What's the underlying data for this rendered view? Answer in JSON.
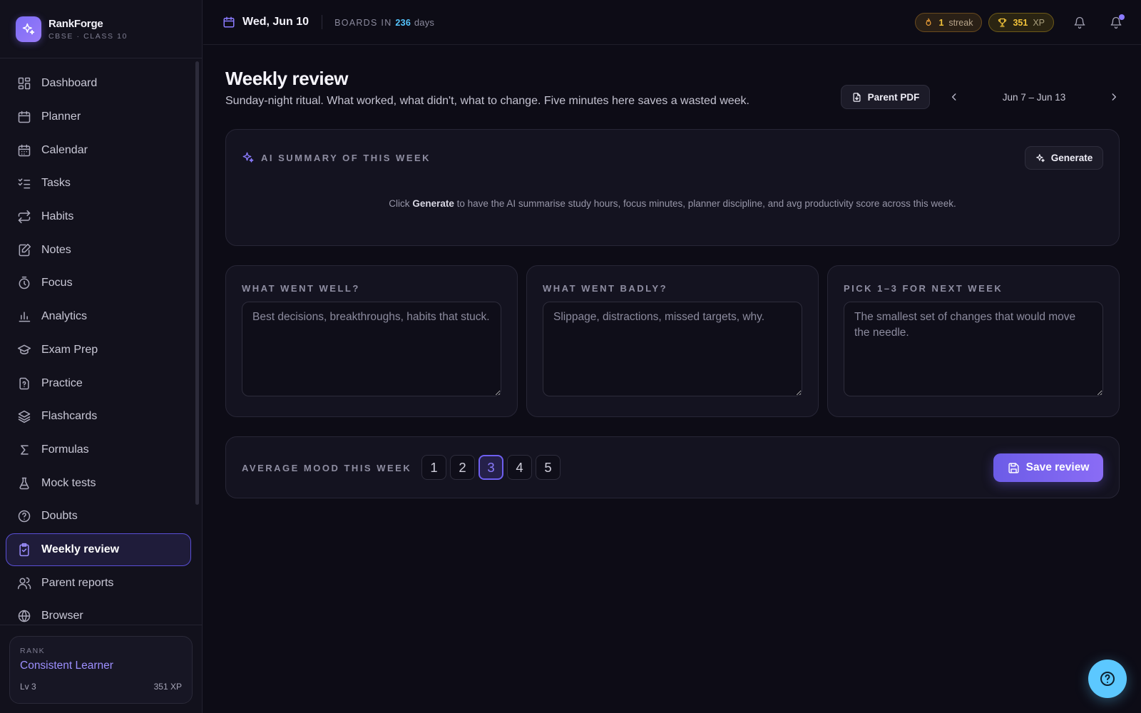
{
  "brand": {
    "name": "RankForge",
    "sub": "CBSE · CLASS 10"
  },
  "sidebar": {
    "items": [
      {
        "label": "Dashboard",
        "icon": "dashboard-icon"
      },
      {
        "label": "Planner",
        "icon": "calendar-icon"
      },
      {
        "label": "Calendar",
        "icon": "calendar-grid-icon"
      },
      {
        "label": "Tasks",
        "icon": "checklist-icon"
      },
      {
        "label": "Habits",
        "icon": "repeat-icon"
      },
      {
        "label": "Notes",
        "icon": "notes-icon"
      },
      {
        "label": "Focus",
        "icon": "timer-icon"
      },
      {
        "label": "Analytics",
        "icon": "bar-chart-icon"
      },
      {
        "label": "Exam Prep",
        "icon": "graduation-cap-icon"
      },
      {
        "label": "Practice",
        "icon": "question-file-icon"
      },
      {
        "label": "Flashcards",
        "icon": "layers-icon"
      },
      {
        "label": "Formulas",
        "icon": "sigma-icon"
      },
      {
        "label": "Mock tests",
        "icon": "flask-icon"
      },
      {
        "label": "Doubts",
        "icon": "help-circle-icon"
      },
      {
        "label": "Weekly review",
        "icon": "clipboard-check-icon",
        "active": true
      },
      {
        "label": "Parent reports",
        "icon": "users-icon"
      },
      {
        "label": "Browser",
        "icon": "globe-icon"
      }
    ],
    "rank": {
      "label": "RANK",
      "title": "Consistent Learner",
      "level": "Lv 3",
      "xp": "351 XP"
    }
  },
  "topbar": {
    "date": "Wed, Jun 10",
    "boards_prefix": "BOARDS IN",
    "boards_days": "236",
    "boards_suffix": "days",
    "streak_count": "1",
    "streak_label": "streak",
    "xp_count": "351",
    "xp_label": "XP"
  },
  "page": {
    "title": "Weekly review",
    "subtitle": "Sunday-night ritual. What worked, what didn't, what to change. Five minutes here saves a wasted week.",
    "pdf_button": "Parent PDF",
    "week_range": "Jun 7 – Jun 13"
  },
  "ai_summary": {
    "heading": "AI SUMMARY OF THIS WEEK",
    "generate_label": "Generate",
    "hint_prefix": "Click",
    "hint_bold": "Generate",
    "hint_suffix": "to have the AI summarise study hours, focus minutes, planner discipline, and avg productivity score across this week."
  },
  "columns": [
    {
      "heading": "WHAT WENT WELL?",
      "placeholder": "Best decisions, breakthroughs, habits that stuck.",
      "value": ""
    },
    {
      "heading": "WHAT WENT BADLY?",
      "placeholder": "Slippage, distractions, missed targets, why.",
      "value": ""
    },
    {
      "heading": "PICK 1–3 FOR NEXT WEEK",
      "placeholder": "The smallest set of changes that would move the needle.",
      "value": ""
    }
  ],
  "mood": {
    "label": "AVERAGE MOOD THIS WEEK",
    "options": [
      "1",
      "2",
      "3",
      "4",
      "5"
    ],
    "selected": "3"
  },
  "save_label": "Save review",
  "colors": {
    "accent": "#7c6cf6",
    "boards_days": "#55c6ff",
    "xp_gold": "#f2c33a",
    "help_fab": "#5cc8ff"
  }
}
